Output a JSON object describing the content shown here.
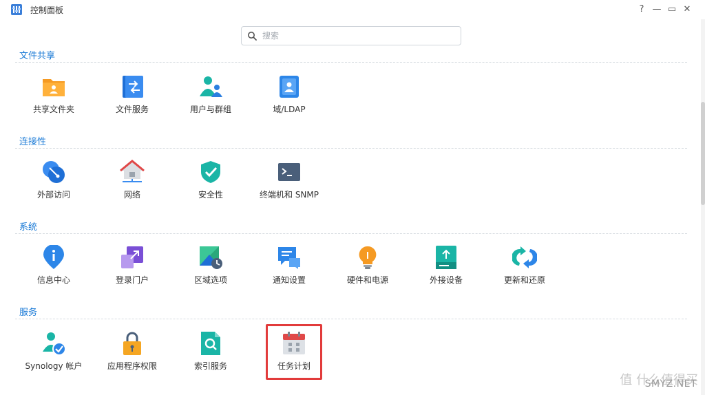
{
  "window": {
    "title": "控制面板",
    "controls": {
      "help": "?",
      "minimize": "—",
      "maximize": "▭",
      "close": "✕"
    }
  },
  "search": {
    "placeholder": "搜索",
    "value": ""
  },
  "sections": {
    "file_sharing": {
      "title": "文件共享",
      "items": [
        "共享文件夹",
        "文件服务",
        "用户与群组",
        "域/LDAP"
      ]
    },
    "connectivity": {
      "title": "连接性",
      "items": [
        "外部访问",
        "网络",
        "安全性",
        "终端机和 SNMP"
      ]
    },
    "system": {
      "title": "系统",
      "items": [
        "信息中心",
        "登录门户",
        "区域选项",
        "通知设置",
        "硬件和电源",
        "外接设备",
        "更新和还原"
      ]
    },
    "services": {
      "title": "服务",
      "items": [
        "Synology 帐户",
        "应用程序权限",
        "索引服务",
        "任务计划"
      ]
    }
  },
  "watermark": {
    "text": "值 什么值得买",
    "site": "SMYZ.NET"
  },
  "colors": {
    "accent": "#1a7ad6",
    "highlight": "#e23b3b"
  }
}
